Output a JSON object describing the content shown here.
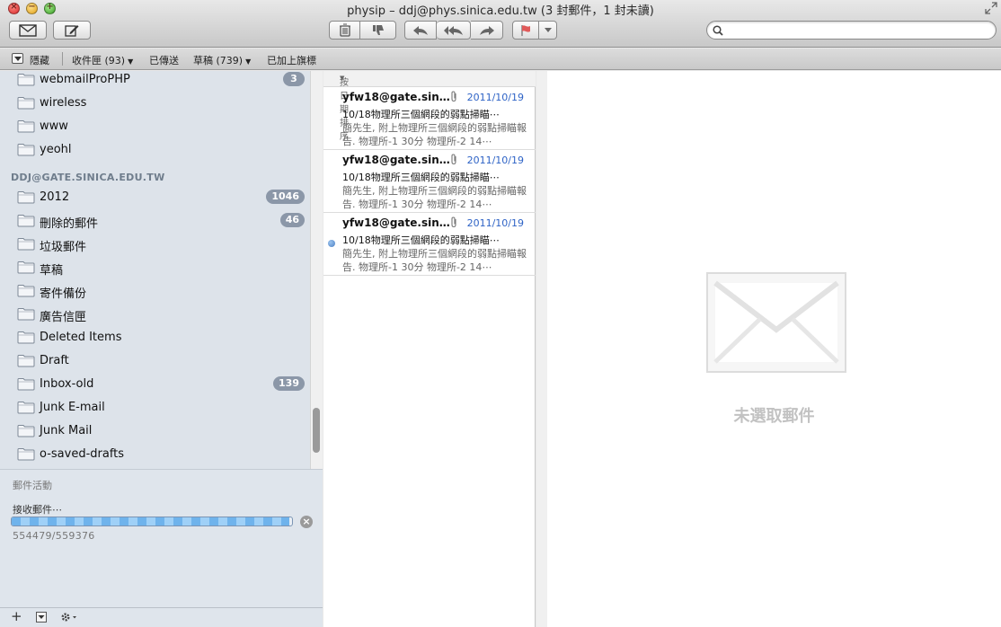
{
  "window": {
    "title": "physip – ddj@phys.sinica.edu.tw (3 封郵件，1 封未讀)"
  },
  "toolbar": {
    "search_placeholder": ""
  },
  "favorites_bar": {
    "hide_label": "隱藏",
    "items": [
      {
        "label": "收件匣 (93)",
        "has_menu": true
      },
      {
        "label": "已傳送",
        "has_menu": false
      },
      {
        "label": "草稿 (739)",
        "has_menu": true
      },
      {
        "label": "已加上旗標",
        "has_menu": false
      }
    ]
  },
  "sidebar": {
    "mailboxes_top": [
      {
        "label": "webmailProPHP",
        "badge": "3"
      },
      {
        "label": "wireless",
        "badge": ""
      },
      {
        "label": "www",
        "badge": ""
      },
      {
        "label": "yeohl",
        "badge": ""
      }
    ],
    "account_header": "DDJ@GATE.SINICA.EDU.TW",
    "mailboxes_account": [
      {
        "label": "2012",
        "badge": "1046"
      },
      {
        "label": "刪除的郵件",
        "badge": "46"
      },
      {
        "label": "垃圾郵件",
        "badge": ""
      },
      {
        "label": "草稿",
        "badge": ""
      },
      {
        "label": "寄件備份",
        "badge": ""
      },
      {
        "label": "廣告信匣",
        "badge": ""
      },
      {
        "label": "Deleted Items",
        "badge": ""
      },
      {
        "label": "Draft",
        "badge": ""
      },
      {
        "label": "Inbox-old",
        "badge": "139"
      },
      {
        "label": "Junk E-mail",
        "badge": ""
      },
      {
        "label": "Junk Mail",
        "badge": ""
      },
      {
        "label": "o-saved-drafts",
        "badge": ""
      }
    ]
  },
  "activity": {
    "title": "郵件活動",
    "task_label": "接收郵件⋯",
    "progress": 0.9898,
    "count": "554479/559376"
  },
  "message_list": {
    "sort_label": "按日期排序",
    "messages": [
      {
        "from": "yfw18@gate.sin…",
        "date": "2011/10/19",
        "subject": "10/18物理所三個網段的弱點掃瞄⋯",
        "preview": "簡先生, 附上物理所三個網段的弱點掃瞄報告. 物理所-1 30分 物理所-2 14⋯",
        "unread": false,
        "attachment": true
      },
      {
        "from": "yfw18@gate.sin…",
        "date": "2011/10/19",
        "subject": "10/18物理所三個網段的弱點掃瞄⋯",
        "preview": "簡先生, 附上物理所三個網段的弱點掃瞄報告. 物理所-1 30分 物理所-2 14⋯",
        "unread": false,
        "attachment": true
      },
      {
        "from": "yfw18@gate.sin…",
        "date": "2011/10/19",
        "subject": "10/18物理所三個網段的弱點掃瞄⋯",
        "preview": "簡先生, 附上物理所三個網段的弱點掃瞄報告. 物理所-1 30分 物理所-2 14⋯",
        "unread": true,
        "attachment": true
      }
    ]
  },
  "preview": {
    "empty_label": "未選取郵件"
  },
  "colors": {
    "date_blue": "#2e63c6",
    "badge_gray": "#8b97a8",
    "sidebar_bg": "#dde3ea"
  }
}
